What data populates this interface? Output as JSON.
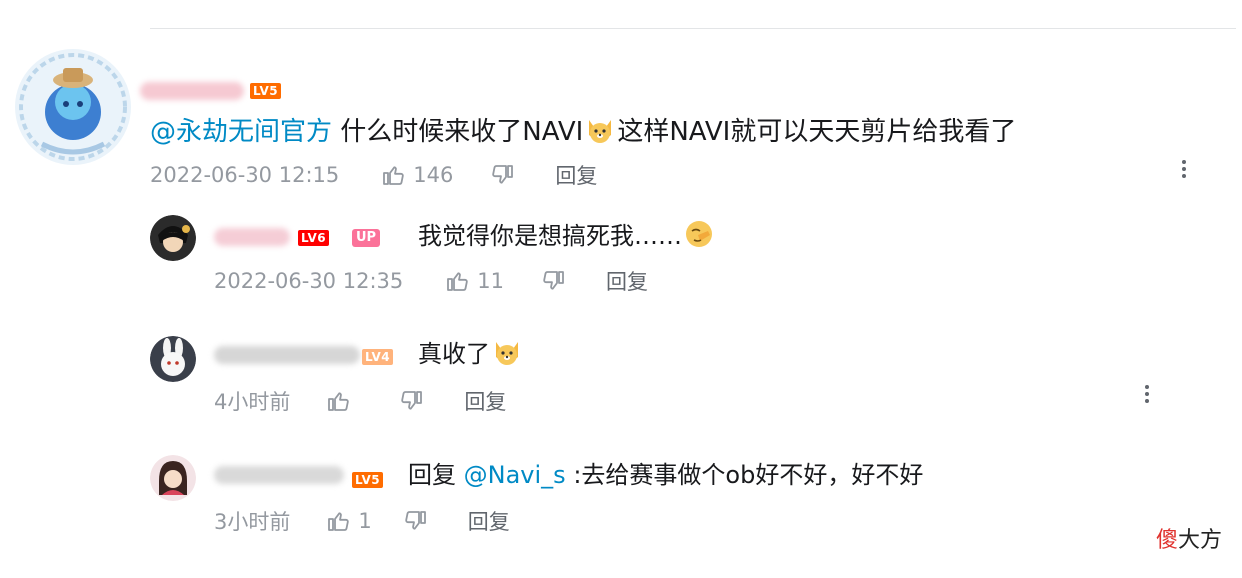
{
  "comment_main": {
    "level": "LV5",
    "mention": "@永劫无间官方",
    "text": " 什么时候来收了NAVI",
    "text_after": "这样NAVI就可以天天剪片给我看了",
    "time": "2022-06-30 12:15",
    "likes": "146",
    "reply_label": "回复"
  },
  "reply_1": {
    "level": "LV6",
    "up_badge": "UP",
    "text": "我觉得你是想搞死我……",
    "time": "2022-06-30 12:35",
    "likes": "11",
    "reply_label": "回复"
  },
  "reply_2": {
    "level": "LV4",
    "text": "真收了",
    "time": "4小时前",
    "reply_label": "回复"
  },
  "reply_3": {
    "level": "LV5",
    "reply_prefix": "回复 ",
    "mention": "@Navi_s",
    "text": " :去给赛事做个ob好不好，好不好",
    "time": "3小时前",
    "likes": "1",
    "reply_label": "回复"
  },
  "watermark": {
    "first": "傻",
    "rest": "大方"
  },
  "colors": {
    "mention": "#008ac5",
    "meta": "#9499a0",
    "up": "#fb7299",
    "lv4": "#ffb37c",
    "lv5": "#ff6c00",
    "lv6": "#ff0000"
  },
  "icons": [
    "thumb-up-icon",
    "thumb-down-icon",
    "more-options-icon",
    "dog-emoji-icon",
    "facepalm-emoji-icon"
  ]
}
